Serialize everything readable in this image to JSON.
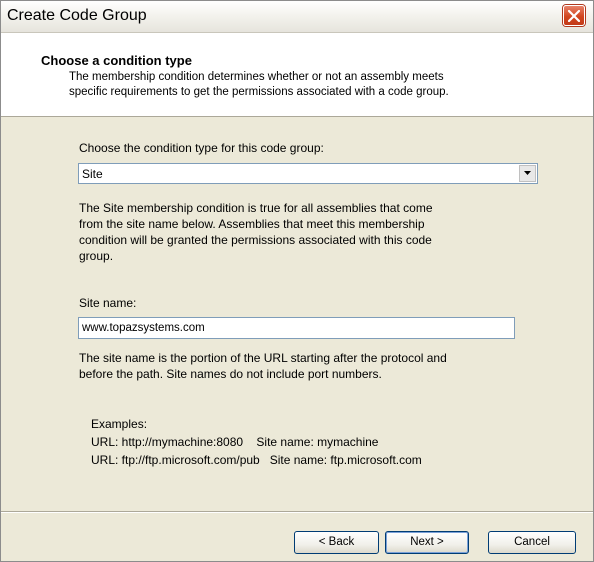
{
  "window": {
    "title": "Create Code Group"
  },
  "header": {
    "title": "Choose a condition type",
    "desc_line1": "The membership condition determines whether or not an assembly meets",
    "desc_line2": "specific requirements to get the permissions associated with a code group."
  },
  "condition": {
    "label": "Choose the condition type for this code group:",
    "selected": "Site"
  },
  "description": {
    "line1": "The Site membership condition is true for all assemblies that come",
    "line2": "from the site name below. Assemblies that meet this membership",
    "line3": "condition will be granted the permissions associated with this code",
    "line4": "group."
  },
  "site": {
    "label": "Site name:",
    "value": "www.topazsystems.com"
  },
  "site_help": {
    "line1": "The site name is the portion of the URL starting after the protocol and",
    "line2": "before the path. Site names do not include port numbers."
  },
  "examples": {
    "label": "Examples:",
    "ex1": "URL: http://mymachine:8080    Site name: mymachine",
    "ex2": "URL: ftp://ftp.microsoft.com/pub   Site name: ftp.microsoft.com"
  },
  "buttons": {
    "back": "< Back",
    "next": "Next >",
    "cancel": "Cancel"
  },
  "colors": {
    "close_button": "#d2461f",
    "header_bg": "#ffffff",
    "dialog_bg": "#ece9d8"
  },
  "icons": {
    "close": "close-icon",
    "dropdown": "chevron-down-icon"
  }
}
